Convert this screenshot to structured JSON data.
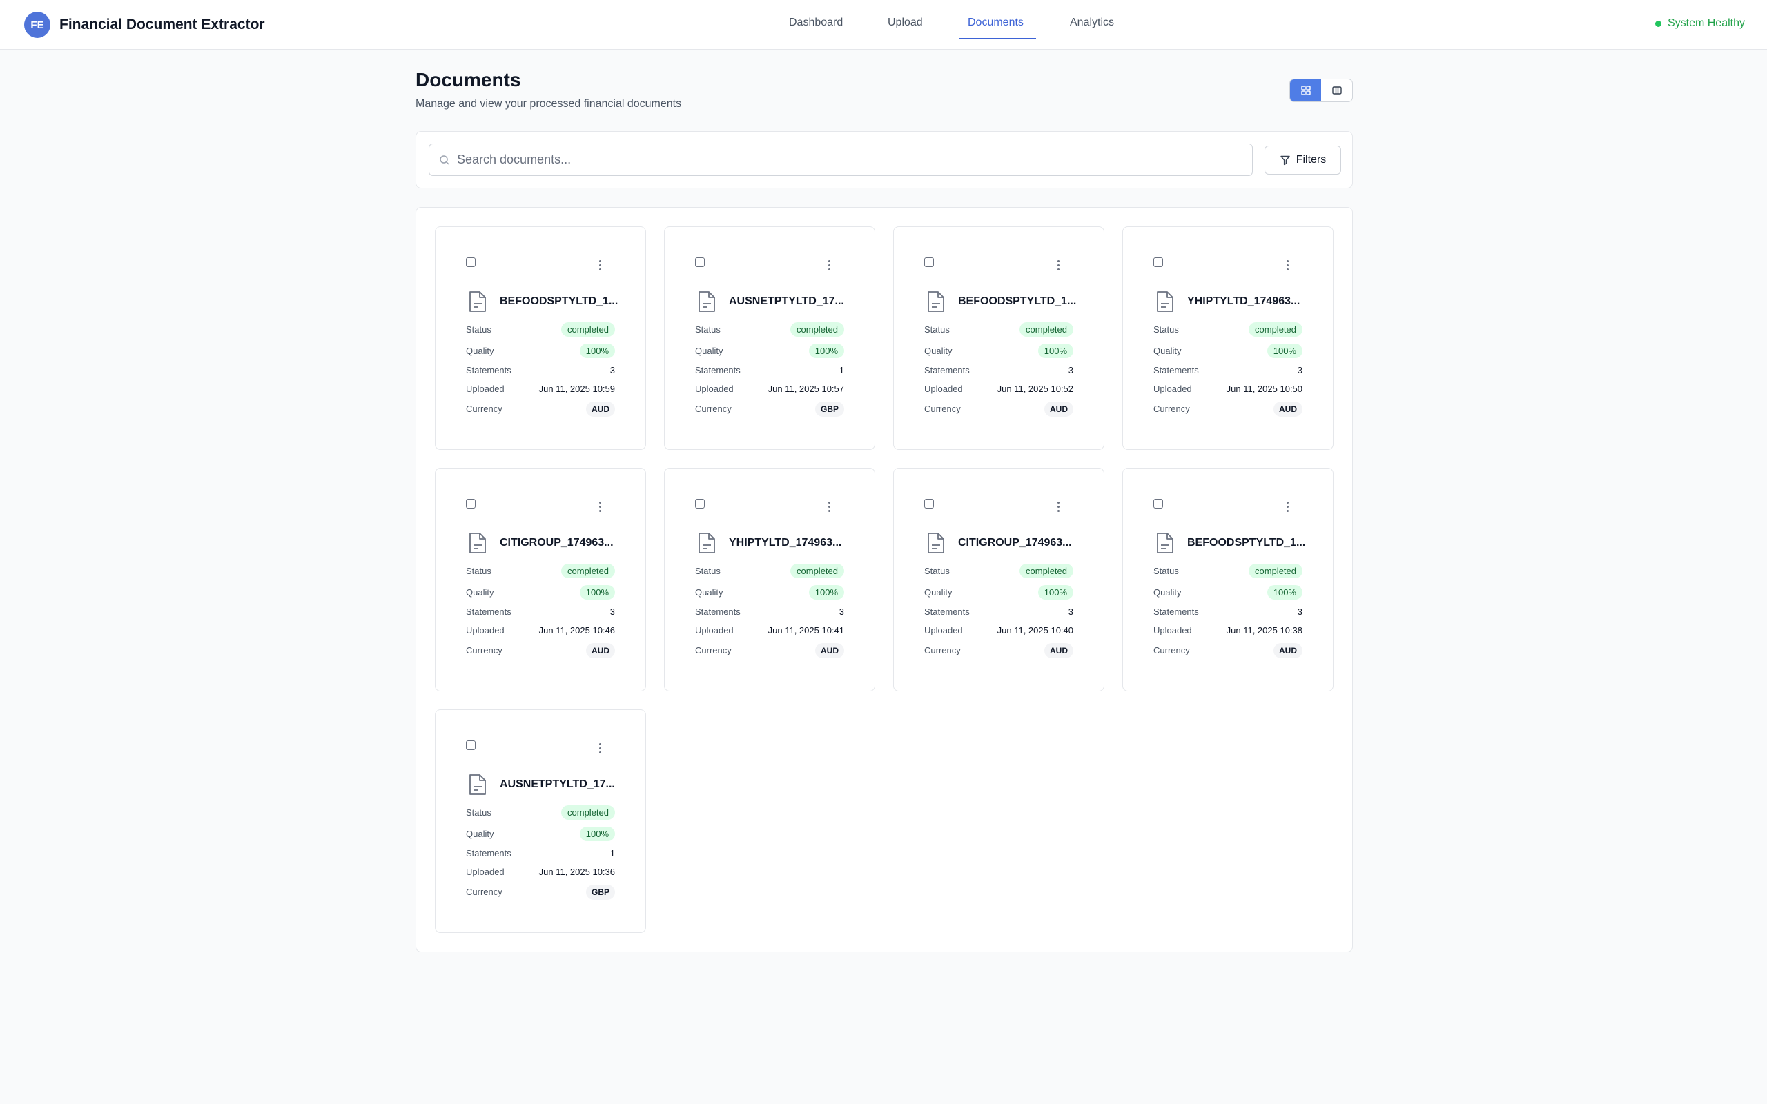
{
  "header": {
    "logo_initials": "FE",
    "app_title": "Financial Document Extractor",
    "nav": [
      {
        "label": "Dashboard"
      },
      {
        "label": "Upload"
      },
      {
        "label": "Documents"
      },
      {
        "label": "Analytics"
      }
    ],
    "active_nav": "Documents",
    "health_status": "System Healthy",
    "health_color": "#22a34a"
  },
  "page": {
    "title": "Documents",
    "subtitle": "Manage and view your processed financial documents",
    "view_mode": "grid"
  },
  "search": {
    "placeholder": "Search documents...",
    "value": "",
    "filters_label": "Filters"
  },
  "labels": {
    "status": "Status",
    "quality": "Quality",
    "statements": "Statements",
    "uploaded": "Uploaded",
    "currency": "Currency"
  },
  "documents": [
    {
      "name": "BEFOODSPTYLTD_1...",
      "status": "completed",
      "quality": "100%",
      "statements": "3",
      "uploaded": "Jun 11, 2025 10:59",
      "currency": "AUD"
    },
    {
      "name": "AUSNETPTYLTD_17...",
      "status": "completed",
      "quality": "100%",
      "statements": "1",
      "uploaded": "Jun 11, 2025 10:57",
      "currency": "GBP"
    },
    {
      "name": "BEFOODSPTYLTD_1...",
      "status": "completed",
      "quality": "100%",
      "statements": "3",
      "uploaded": "Jun 11, 2025 10:52",
      "currency": "AUD"
    },
    {
      "name": "YHIPTYLTD_174963...",
      "status": "completed",
      "quality": "100%",
      "statements": "3",
      "uploaded": "Jun 11, 2025 10:50",
      "currency": "AUD"
    },
    {
      "name": "CITIGROUP_174963...",
      "status": "completed",
      "quality": "100%",
      "statements": "3",
      "uploaded": "Jun 11, 2025 10:46",
      "currency": "AUD"
    },
    {
      "name": "YHIPTYLTD_174963...",
      "status": "completed",
      "quality": "100%",
      "statements": "3",
      "uploaded": "Jun 11, 2025 10:41",
      "currency": "AUD"
    },
    {
      "name": "CITIGROUP_174963...",
      "status": "completed",
      "quality": "100%",
      "statements": "3",
      "uploaded": "Jun 11, 2025 10:40",
      "currency": "AUD"
    },
    {
      "name": "BEFOODSPTYLTD_1...",
      "status": "completed",
      "quality": "100%",
      "statements": "3",
      "uploaded": "Jun 11, 2025 10:38",
      "currency": "AUD"
    },
    {
      "name": "AUSNETPTYLTD_17...",
      "status": "completed",
      "quality": "100%",
      "statements": "1",
      "uploaded": "Jun 11, 2025 10:36",
      "currency": "GBP"
    }
  ]
}
